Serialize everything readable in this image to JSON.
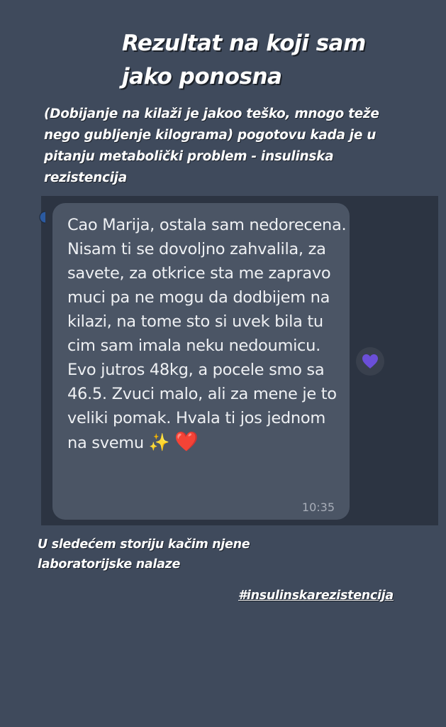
{
  "story": {
    "title": "Rezultat na koji sam jako ponosna",
    "subtitle": "(Dobijanje na kilaži je jakoo teško, mnogo teže nego gubljenje kilograma) pogotovu kada je u pitanju metabolički problem - insulinska rezistencija",
    "caption": "U sledećem storiju kačim njene laboratorijske nalaze",
    "hashtag": "#insulinskarezistencija"
  },
  "message": {
    "text": "Cao Marija, ostala sam nedorecena. Nisam ti se dovoljno zahvalila, za savete, za otkrice sta me zapravo muci pa ne mogu da dodbijem na kilazi, na tome sto si uvek bila tu cim sam imala neku nedoumicu. Evo jutros 48kg, a pocele smo sa 46.5. Zvuci malo, ali za mene je to veliki pomak. Hvala ti jos jednom na svemu",
    "emoji_sparkles": "✨",
    "emoji_heart": "❤️",
    "time": "10:35"
  },
  "reaction": {
    "icon": "purple-heart-icon",
    "color": "#6b4fd8"
  },
  "colors": {
    "background": "#3f4a5c",
    "panel": "#2c3442",
    "bubble": "#4b5565",
    "heart": "#e0242e",
    "sparkles": "#f5c518"
  }
}
